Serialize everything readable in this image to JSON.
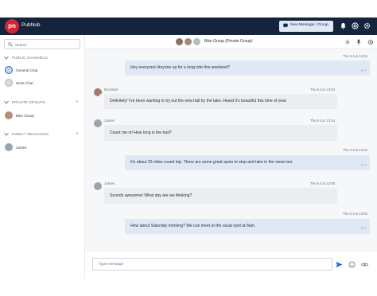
{
  "app": {
    "logo_text": "pn",
    "brand": "PubNub",
    "new_message_label": "New Message / Group"
  },
  "sidebar": {
    "search_placeholder": "Search",
    "sections": {
      "public": "PUBLIC CHANNELS",
      "private": "PRIVATE GROUPS",
      "direct": "DIRECT MESSAGES"
    },
    "public_channels": [
      "General Chat",
      "Work Chat"
    ],
    "private_groups": [
      "Bike Group"
    ],
    "direct_messages": [
      "James"
    ]
  },
  "channel": {
    "title": "Bike Group (Private Group)"
  },
  "messages": [
    {
      "direction": "out",
      "timestamp": "Thu 6 Jun 13:53",
      "text": "Hey everyone! Anyone up for a long ride this weekend?"
    },
    {
      "direction": "in",
      "sender": "Brooklyn",
      "timestamp": "Thu 6 Jun 13:53",
      "text": "Definitely! I've been wanting to try out the new trail by the lake. Heard it's beautiful this time of year."
    },
    {
      "direction": "in",
      "sender": "James",
      "timestamp": "Thu 6 Jun 13:54",
      "text": "Count me in! How long is the trail?"
    },
    {
      "direction": "out",
      "timestamp": "Thu 6 Jun 13:54",
      "text": "It's about 25 miles round trip. There are some great spots to stop and take in the views too."
    },
    {
      "direction": "in",
      "sender": "James",
      "timestamp": "Thu 6 Jun 13:55",
      "text": "Sounds awesome! What day are we thinking?"
    },
    {
      "direction": "out",
      "timestamp": "Thu 6 Jun 13:55",
      "text": "How about Saturday morning? We can meet at the usual spot at 8am."
    }
  ],
  "composer": {
    "placeholder": "Type message"
  },
  "icons": {
    "sent_status": "double-check-icon",
    "online_status": "green-dot"
  },
  "colors": {
    "topbar": "#14243c",
    "accent": "#1b6ad6",
    "outgoing_bubble": "#dfe9f6",
    "incoming_bubble": "#ebedf0",
    "online": "#22c55e"
  }
}
